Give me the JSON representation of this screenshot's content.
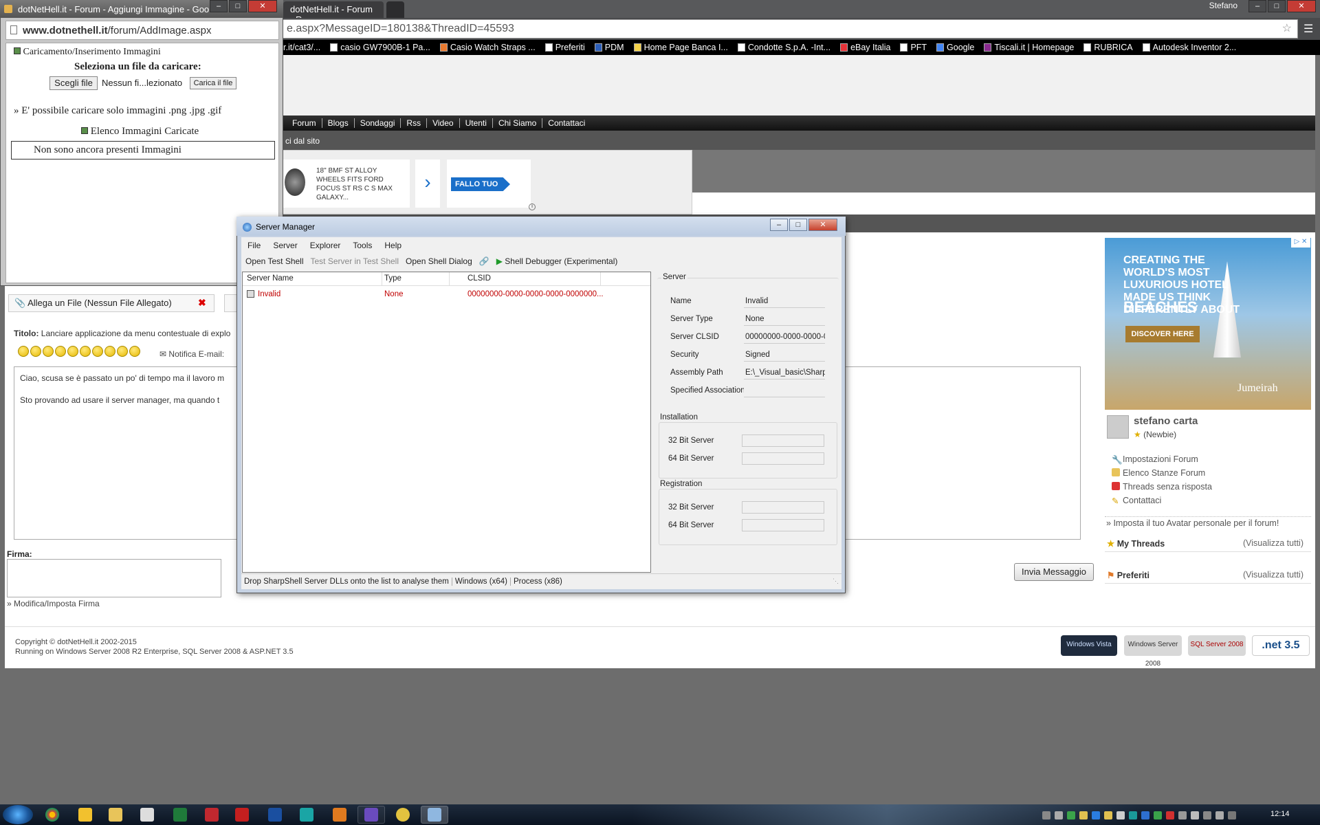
{
  "chrome": {
    "tabs": [
      "dotNetHell.it - Forum - Aggiungi Immagine - Goo...",
      "dotNetHell.it - Forum - R"
    ],
    "user": "Stefano",
    "address": "e.aspx?MessageID=180138&ThreadID=45593",
    "bookmarks": [
      "r.it/cat3/...",
      "casio GW7900B-1 Pa...",
      "Casio Watch Straps ...",
      "Preferiti",
      "PDM",
      "Home Page Banca I...",
      "Condotte S.p.A. -Int...",
      "eBay Italia",
      "PFT",
      "Google",
      "Tiscali.it | Homepage",
      "RUBRICA",
      "Autodesk Inventor 2..."
    ]
  },
  "site": {
    "nav": [
      "Forum",
      "Blogs",
      "Sondaggi",
      "Rss",
      "Video",
      "Utenti",
      "Chi Siamo",
      "Contattaci"
    ],
    "subnav": "ci dal sito",
    "ad": {
      "text": "18\" BMF ST ALLOY WHEELS FITS FORD FOCUS ST RS C S MAX GALAXY...",
      "cta": "FALLO TUO"
    }
  },
  "post": {
    "attach_prefix": "Allega un File",
    "attach_status": "(Nessun File Allegato)",
    "title_label": "Titolo:",
    "title_value": "Lanciare applicazione da menu contestuale di explo",
    "notify": "Notifica E-mail:",
    "body": [
      "Ciao, scusa se è passato un po' di tempo ma il lavoro m",
      "Sto provando ad usare il server manager, ma quando t"
    ],
    "firma_label": "Firma:",
    "firma_link": "Modifica/Imposta Firma",
    "send": "Invia Messaggio"
  },
  "footer": {
    "copyright": "Copyright © dotNetHell.it 2002-2015",
    "running": "Running on Windows Server 2008 R2 Enterprise, SQL Server 2008 & ASP.NET 3.5",
    "badges": [
      "Windows Vista",
      "Windows Server 2008",
      "SQL Server 2008",
      ".net 3.5"
    ]
  },
  "sidebar": {
    "ad": {
      "headline": "CREATING THE WORLD'S MOST LUXURIOUS HOTEL MADE US THINK DIFFERENTLY ABOUT",
      "headline2": "BEACHES",
      "button": "DISCOVER HERE",
      "brand": "Jumeirah"
    },
    "user_name": "stefano carta",
    "user_rank": "(Newbie)",
    "links": [
      "Impostazioni Forum",
      "Elenco Stanze Forum",
      "Threads senza risposta",
      "Contattaci"
    ],
    "avatar_link": "Imposta il tuo Avatar personale per il forum!",
    "my_threads": "My Threads",
    "preferiti": "Preferiti",
    "view_all": "(Visualizza tutti)"
  },
  "popup": {
    "title": "dotNetHell.it - Forum - Aggiungi Immagine - Goo...",
    "url_domain": "www.dotnethell.it",
    "url_path": "/forum/AddImage.aspx",
    "heading": "Caricamento/Inserimento Immagini",
    "select": "Seleziona un file da caricare:",
    "choose": "Scegli file",
    "nofile": "Nessun fi...lezionato",
    "upload": "Carica il file",
    "note": "E' possibile caricare solo immagini .png .jpg .gif",
    "list": "Elenco Immagini Caricate",
    "empty": "Non sono ancora presenti Immagini"
  },
  "server_manager": {
    "title": "Server Manager",
    "menu": [
      "File",
      "Server",
      "Explorer",
      "Tools",
      "Help"
    ],
    "toolbar": [
      "Open Test Shell",
      "Test Server in Test Shell",
      "Open Shell Dialog",
      "Shell Debugger (Experimental)"
    ],
    "columns": [
      "Server Name",
      "Type",
      "CLSID"
    ],
    "rows": [
      {
        "name": "Invalid",
        "type": "None",
        "clsid": "00000000-0000-0000-0000-0000000..."
      }
    ],
    "server_group": "Server",
    "props": [
      {
        "label": "Name",
        "value": "Invalid"
      },
      {
        "label": "Server Type",
        "value": "None"
      },
      {
        "label": "Server CLSID",
        "value": "00000000-0000-0000-00"
      },
      {
        "label": "Security",
        "value": "Signed"
      },
      {
        "label": "Assembly Path",
        "value": "E:\\_Visual_basic\\Sharp'"
      },
      {
        "label": "Specified Associations",
        "value": ""
      }
    ],
    "installation_group": "Installation",
    "registration_group": "Registration",
    "bit32": "32 Bit Server",
    "bit64": "64 Bit Server",
    "status": [
      "Drop SharpShell Server DLLs onto the list to analyse them",
      "Windows (x64)",
      "Process (x86)"
    ]
  },
  "taskbar": {
    "clock": "12:14"
  },
  "colors": {
    "invalid_row": "#c00000",
    "accent": "#1a6fc9"
  }
}
